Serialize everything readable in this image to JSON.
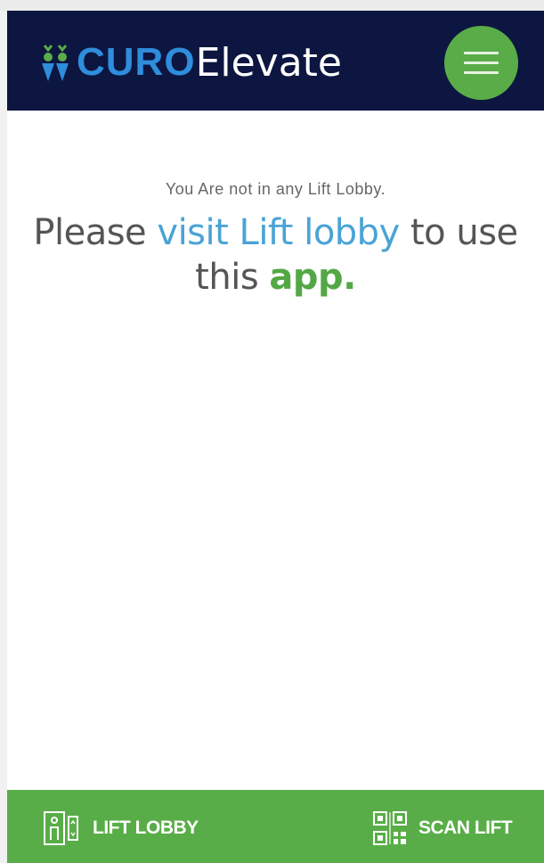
{
  "header": {
    "brand_strong": "CURO",
    "brand_light": "Elevate",
    "menu_icon": "hamburger-menu-icon"
  },
  "message": {
    "subtitle": "You Are not in any Lift Lobby.",
    "prefix": "Please ",
    "link": "visit Lift lobby",
    "middle": " to use this ",
    "emphasis": "app."
  },
  "bottom_nav": {
    "lift_lobby": {
      "label": "LIFT LOBBY",
      "icon": "lift-lobby-icon"
    },
    "scan_lift": {
      "label": "SCAN LIFT",
      "icon": "qr-scan-icon"
    }
  },
  "colors": {
    "header_bg": "#0c1640",
    "brand_blue": "#2f8ddc",
    "accent_green": "#59ad48",
    "link_blue": "#4aa3d6"
  }
}
